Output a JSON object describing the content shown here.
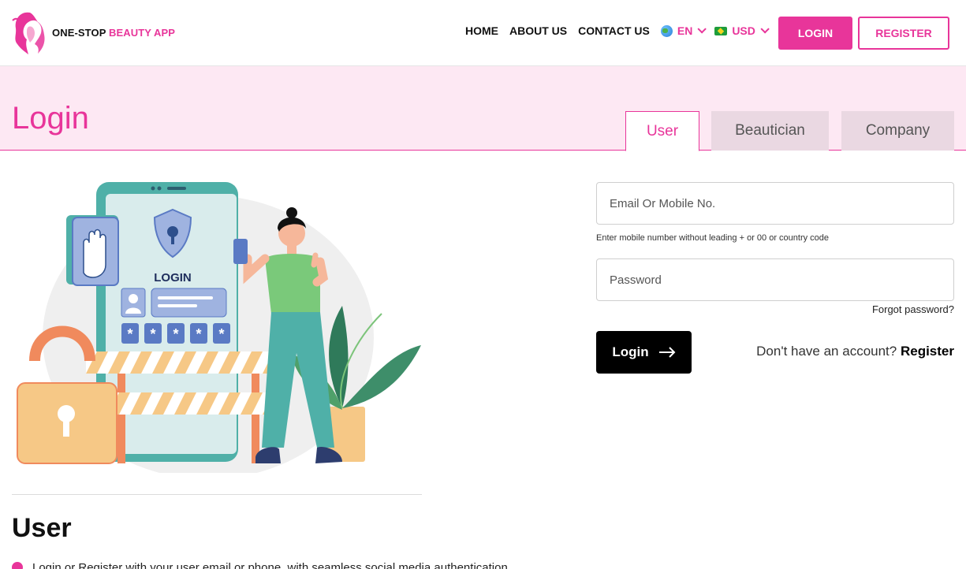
{
  "brand": {
    "name_part1": "ONE-STOP",
    "name_part2": "BEAUTY APP",
    "accent": "#e8359a"
  },
  "nav": {
    "items": [
      "HOME",
      "ABOUT US",
      "CONTACT US"
    ],
    "language": "EN",
    "currency": "USD",
    "login_label": "LOGIN",
    "register_label": "REGISTER"
  },
  "page": {
    "title": "Login",
    "tabs": [
      {
        "label": "User",
        "active": true
      },
      {
        "label": "Beautician",
        "active": false
      },
      {
        "label": "Company",
        "active": false
      }
    ]
  },
  "illustration": {
    "login_text": "LOGIN",
    "password_mask": "*"
  },
  "form": {
    "email_placeholder": "Email Or Mobile No.",
    "email_value": "",
    "hint": "Enter mobile number without leading + or 00 or country code",
    "password_placeholder": "Password",
    "password_value": "",
    "forgot_label": "Forgot password?",
    "submit_label": "Login",
    "no_account_text": "Don't have an account?",
    "register_link": "Register"
  },
  "info": {
    "section_title": "User",
    "bullet_text": "Login or Register with your user email or phone, with seamless social media authentication"
  }
}
